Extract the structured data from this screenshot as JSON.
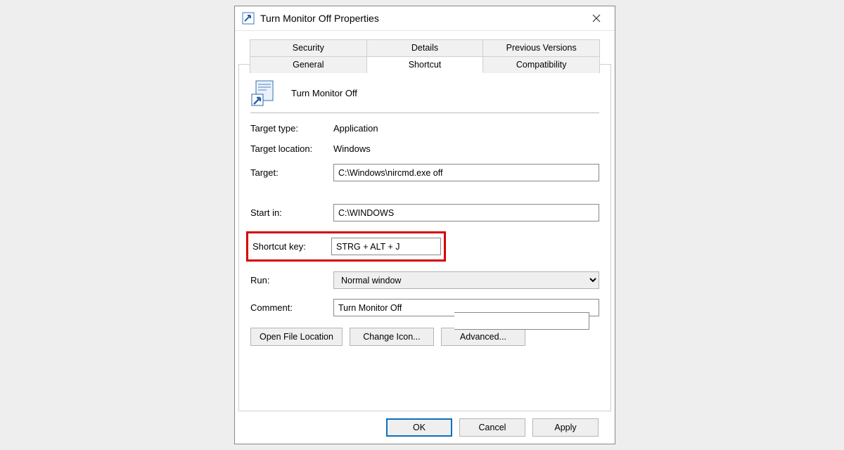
{
  "window": {
    "title": "Turn Monitor Off Properties"
  },
  "tabs": {
    "back": [
      "Security",
      "Details",
      "Previous Versions"
    ],
    "front": [
      "General",
      "Shortcut",
      "Compatibility"
    ],
    "active": "Shortcut"
  },
  "shortcut": {
    "app_name": "Turn Monitor Off",
    "labels": {
      "target_type": "Target type:",
      "target_location": "Target location:",
      "target": "Target:",
      "start_in": "Start in:",
      "shortcut_key": "Shortcut key:",
      "run": "Run:",
      "comment": "Comment:"
    },
    "values": {
      "target_type": "Application",
      "target_location": "Windows",
      "target": "C:\\Windows\\nircmd.exe off",
      "start_in": "C:\\WINDOWS",
      "shortcut_key": "STRG + ALT + J",
      "run": "Normal window",
      "comment": "Turn Monitor Off"
    },
    "buttons": {
      "open_location": "Open File Location",
      "change_icon": "Change Icon...",
      "advanced": "Advanced..."
    }
  },
  "footer": {
    "ok": "OK",
    "cancel": "Cancel",
    "apply": "Apply"
  }
}
